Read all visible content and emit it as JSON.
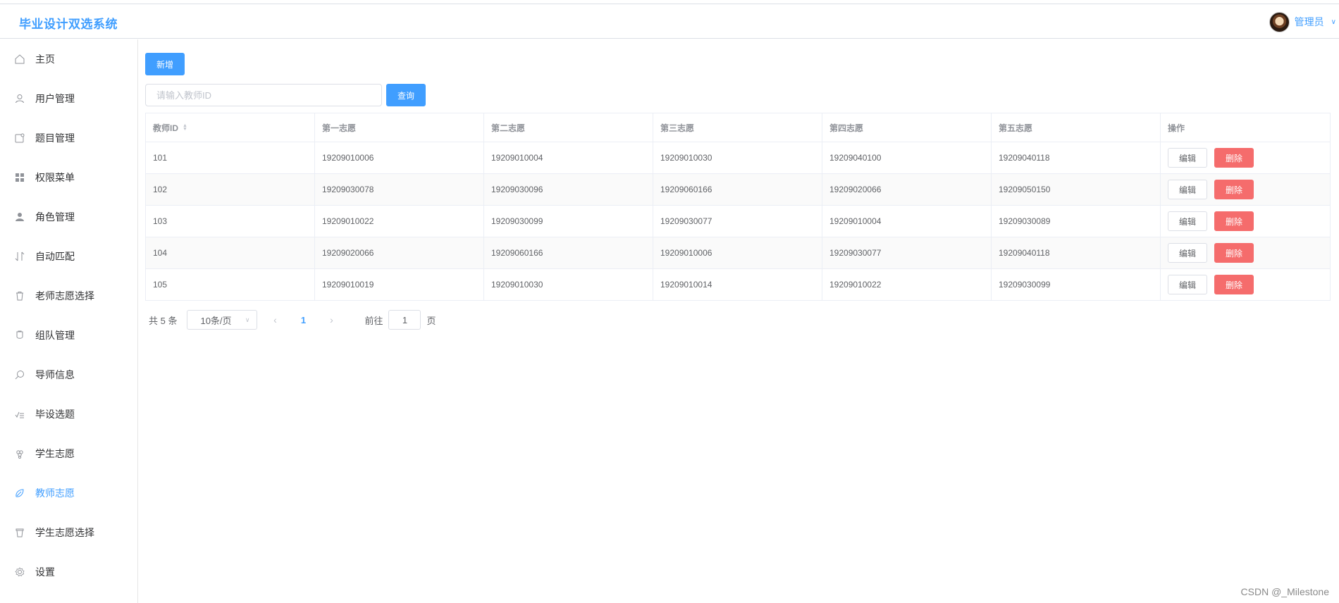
{
  "header": {
    "app_title": "毕业设计双选系统",
    "user_name": "管理员"
  },
  "sidebar": {
    "items": [
      {
        "label": "主页",
        "icon": "home-icon"
      },
      {
        "label": "用户管理",
        "icon": "user-icon"
      },
      {
        "label": "题目管理",
        "icon": "folder-icon"
      },
      {
        "label": "权限菜单",
        "icon": "grid-icon"
      },
      {
        "label": "角色管理",
        "icon": "person-icon"
      },
      {
        "label": "自动匹配",
        "icon": "sort-icon"
      },
      {
        "label": "老师志愿选择",
        "icon": "delete-icon"
      },
      {
        "label": "组队管理",
        "icon": "cup-icon"
      },
      {
        "label": "导师信息",
        "icon": "search-icon"
      },
      {
        "label": "毕设选题",
        "icon": "check-list-icon"
      },
      {
        "label": "学生志愿",
        "icon": "grape-icon"
      },
      {
        "label": "教师志愿",
        "icon": "coin-icon"
      },
      {
        "label": "学生志愿选择",
        "icon": "trash-icon"
      },
      {
        "label": "设置",
        "icon": "setting-icon"
      }
    ],
    "active_index": 11
  },
  "toolbar": {
    "add_label": "新增",
    "search_placeholder": "请输入教师ID",
    "search_value": "",
    "search_label": "查询"
  },
  "table": {
    "columns": [
      "教师ID",
      "第一志愿",
      "第二志愿",
      "第三志愿",
      "第四志愿",
      "第五志愿",
      "操作"
    ],
    "edit_label": "编辑",
    "delete_label": "删除",
    "rows": [
      [
        "101",
        "19209010006",
        "19209010004",
        "19209010030",
        "19209040100",
        "19209040118"
      ],
      [
        "102",
        "19209030078",
        "19209030096",
        "19209060166",
        "19209020066",
        "19209050150"
      ],
      [
        "103",
        "19209010022",
        "19209030099",
        "19209030077",
        "19209010004",
        "19209030089"
      ],
      [
        "104",
        "19209020066",
        "19209060166",
        "19209010006",
        "19209030077",
        "19209040118"
      ],
      [
        "105",
        "19209010019",
        "19209010030",
        "19209010014",
        "19209010022",
        "19209030099"
      ]
    ]
  },
  "pagination": {
    "total_text": "共 5 条",
    "page_size": "10条/页",
    "current_page": "1",
    "goto_prefix": "前往",
    "goto_value": "1",
    "goto_suffix": "页"
  },
  "watermark": "CSDN @_Milestone",
  "colors": {
    "primary": "#409eff",
    "danger": "#f56c6c",
    "border": "#ebeef5"
  }
}
